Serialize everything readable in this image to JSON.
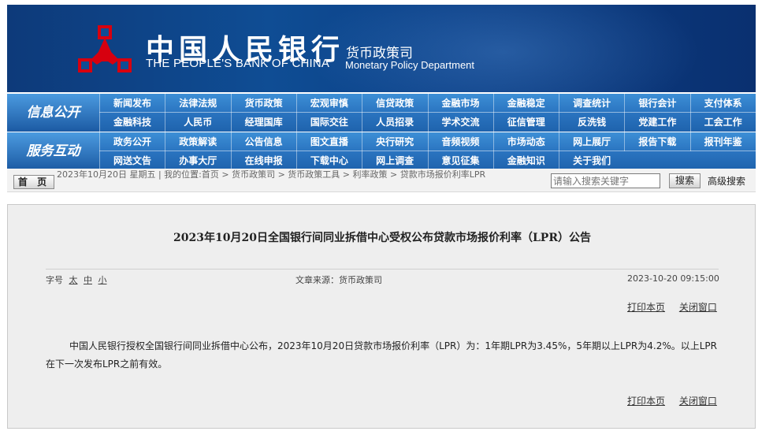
{
  "banner": {
    "name_cn": "中国人民银行",
    "name_en": "THE PEOPLE'S BANK OF CHINA",
    "dept_cn": "货币政策司",
    "dept_en": "Monetary Policy Department",
    "bg_color": "#0f4d94",
    "logo_color": "#d7000f"
  },
  "nav": {
    "group1": {
      "title": "信息公开",
      "row1": [
        "新闻发布",
        "法律法规",
        "货币政策",
        "宏观审慎",
        "信贷政策",
        "金融市场",
        "金融稳定",
        "调查统计",
        "银行会计",
        "支付体系"
      ],
      "row2": [
        "金融科技",
        "人民币",
        "经理国库",
        "国际交往",
        "人员招录",
        "学术交流",
        "征信管理",
        "反洗钱",
        "党建工作",
        "工会工作"
      ]
    },
    "group2": {
      "title": "服务互动",
      "row1": [
        "政务公开",
        "政策解读",
        "公告信息",
        "图文直播",
        "央行研究",
        "音频视频",
        "市场动态",
        "网上展厅",
        "报告下载",
        "报刊年鉴"
      ],
      "row2": [
        "网送文告",
        "办事大厅",
        "在线申报",
        "下载中心",
        "网上调查",
        "意见征集",
        "金融知识",
        "关于我们"
      ]
    }
  },
  "crumbbar": {
    "home_label": "首 页",
    "breadcrumb": "2023年10月20日 星期五 | 我的位置:首页 > 货币政策司 > 货币政策工具 > 利率政策 > 贷款市场报价利率LPR",
    "search_placeholder": "请输入搜索关键字",
    "search_button": "搜索",
    "advanced_search": "高级搜索"
  },
  "article": {
    "title": "2023年10月20日全国银行间同业拆借中心受权公布贷款市场报价利率（LPR）公告",
    "font_size_label": "字号",
    "size_large": "太",
    "size_medium": "中",
    "size_small": "小",
    "source": "文章来源：货币政策司",
    "datetime": "2023-10-20 09:15:00",
    "print": "打印本页",
    "close": "关闭窗口",
    "body": "中国人民银行授权全国银行间同业拆借中心公布，2023年10月20日贷款市场报价利率（LPR）为：1年期LPR为3.45%，5年期以上LPR为4.2%。以上LPR在下一次发布LPR之前有效。"
  }
}
